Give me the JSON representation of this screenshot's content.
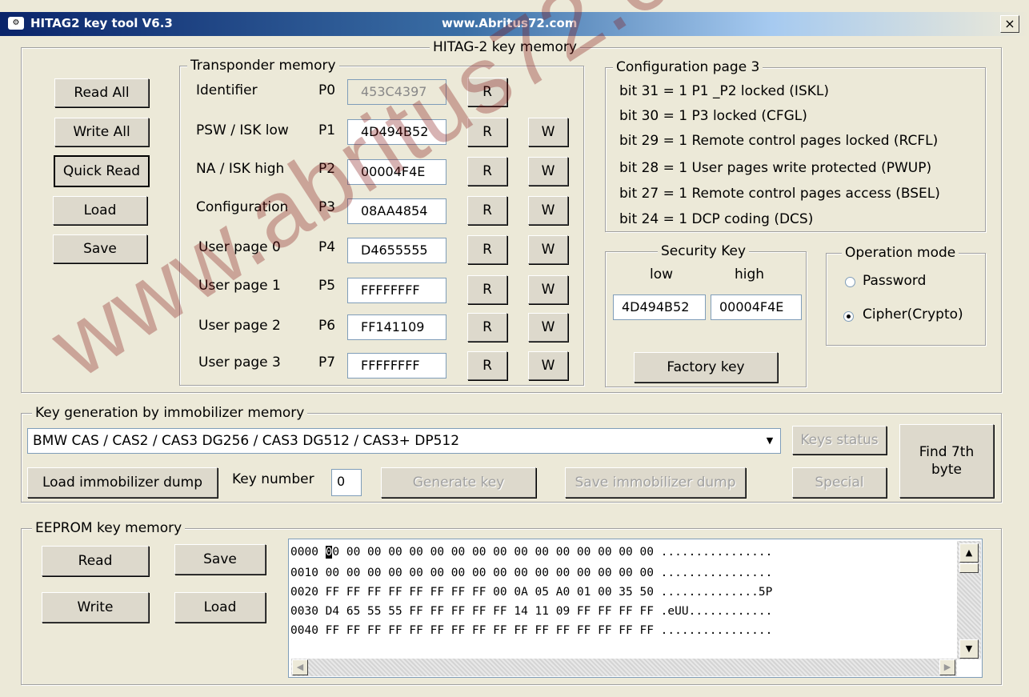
{
  "window": {
    "title": "HITAG2 key tool V6.3",
    "url": "www.Abritus72.com",
    "close_glyph": "×"
  },
  "main_group": {
    "legend": "HITAG-2 key memory"
  },
  "side_buttons": {
    "read_all": "Read All",
    "write_all": "Write All",
    "quick_read": "Quick Read",
    "load": "Load",
    "save": "Save"
  },
  "transponder": {
    "legend": "Transponder memory",
    "rows": [
      {
        "name": "Identifier",
        "page": "P0",
        "value": "453C4397",
        "r": "R",
        "w": ""
      },
      {
        "name": "PSW / ISK low",
        "page": "P1",
        "value": "4D494B52",
        "r": "R",
        "w": "W"
      },
      {
        "name": "NA / ISK high",
        "page": "P2",
        "value": "00004F4E",
        "r": "R",
        "w": "W"
      },
      {
        "name": "Configuration",
        "page": "P3",
        "value": "08AA4854",
        "r": "R",
        "w": "W"
      },
      {
        "name": "User page 0",
        "page": "P4",
        "value": "D4655555",
        "r": "R",
        "w": "W"
      },
      {
        "name": "User page 1",
        "page": "P5",
        "value": "FFFFFFFF",
        "r": "R",
        "w": "W"
      },
      {
        "name": "User page 2",
        "page": "P6",
        "value": "FF141109",
        "r": "R",
        "w": "W"
      },
      {
        "name": "User page 3",
        "page": "P7",
        "value": "FFFFFFFF",
        "r": "R",
        "w": "W"
      }
    ]
  },
  "config_page": {
    "legend": "Configuration page 3",
    "lines": [
      "bit 31 = 1 P1 _P2 locked (ISKL)",
      "bit 30 = 1 P3 locked (CFGL)",
      "bit 29 = 1 Remote control pages locked (RCFL)",
      "bit 28 = 1 User pages write protected (PWUP)",
      "bit 27 = 1 Remote control pages access (BSEL)",
      "bit 24 = 1 DCP coding (DCS)"
    ]
  },
  "security_key": {
    "legend": "Security Key",
    "low_label": "low",
    "high_label": "high",
    "low_value": "4D494B52",
    "high_value": "00004F4E",
    "factory_button": "Factory key"
  },
  "operation_mode": {
    "legend": "Operation mode",
    "options": [
      "Password",
      "Cipher(Crypto)"
    ],
    "selected": "Cipher(Crypto)"
  },
  "key_generation": {
    "legend": "Key generation by immobilizer memory",
    "selected_option": "BMW CAS / CAS2 / CAS3 DG256 / CAS3 DG512 / CAS3+ DP512",
    "keys_status": "Keys status",
    "find_7th": "Find 7th byte",
    "load_dump": "Load immobilizer dump",
    "key_number_label": "Key number",
    "key_number_value": "0",
    "generate_key": "Generate key",
    "save_dump": "Save immobilizer dump",
    "special": "Special"
  },
  "eeprom": {
    "legend": "EEPROM key memory",
    "read": "Read",
    "save": "Save",
    "write": "Write",
    "load": "Load",
    "hex_cursor": "0",
    "hex_lines": [
      "0000 00 00 00 00 00 00 00 00 00 00 00 00 00 00 00 00 ................",
      "0010 00 00 00 00 00 00 00 00 00 00 00 00 00 00 00 00 ................",
      "0020 FF FF FF FF FF FF FF FF 00 0A 05 A0 01 00 35 50 ..............5P",
      "0030 D4 65 55 55 FF FF FF FF FF 14 11 09 FF FF FF FF .eUU............",
      "0040 FF FF FF FF FF FF FF FF FF FF FF FF FF FF FF FF ................"
    ]
  },
  "watermark": "www.abritus72.com"
}
